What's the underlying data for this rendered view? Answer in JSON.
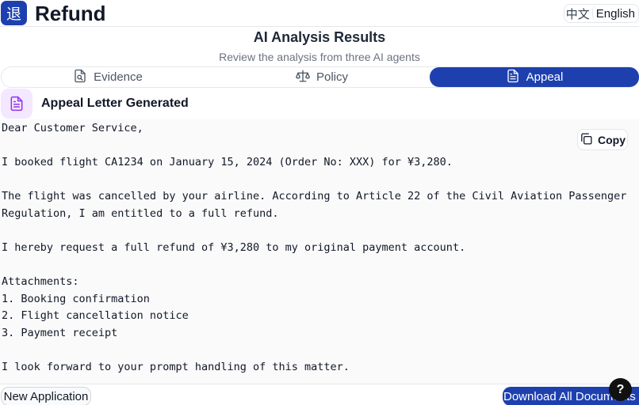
{
  "header": {
    "logo_glyph": "退",
    "title": "Refund",
    "lang_zh": "中文",
    "lang_en": "English"
  },
  "section": {
    "title": "AI Analysis Results",
    "subtitle": "Review the analysis from three AI agents"
  },
  "tabs": [
    {
      "label": "Evidence",
      "icon": "document-search-icon",
      "active": false
    },
    {
      "label": "Policy",
      "icon": "scale-icon",
      "active": false
    },
    {
      "label": "Appeal",
      "icon": "document-icon",
      "active": true
    }
  ],
  "card": {
    "title": "Appeal Letter Generated",
    "icon": "document-icon",
    "copy_label": "Copy"
  },
  "letter": {
    "lines": [
      "Dear Customer Service,",
      "",
      "I booked flight CA1234 on January 15, 2024 (Order No: XXX) for ¥3,280.",
      "",
      "The flight was cancelled by your airline. According to Article 22 of the Civil Aviation Passenger",
      "Regulation, I am entitled to a full refund.",
      "",
      "I hereby request a full refund of ¥3,280 to my original payment account.",
      "",
      "Attachments:",
      "1. Booking confirmation",
      "2. Flight cancellation notice",
      "3. Payment receipt",
      "",
      "I look forward to your prompt handling of this matter."
    ]
  },
  "footer": {
    "new_label": "New Application",
    "download_label": "Download All Documents",
    "help_label": "?"
  },
  "colors": {
    "primary": "#1e40af",
    "accent_soft": "#f3e8ff",
    "accent_icon": "#9333ea"
  }
}
